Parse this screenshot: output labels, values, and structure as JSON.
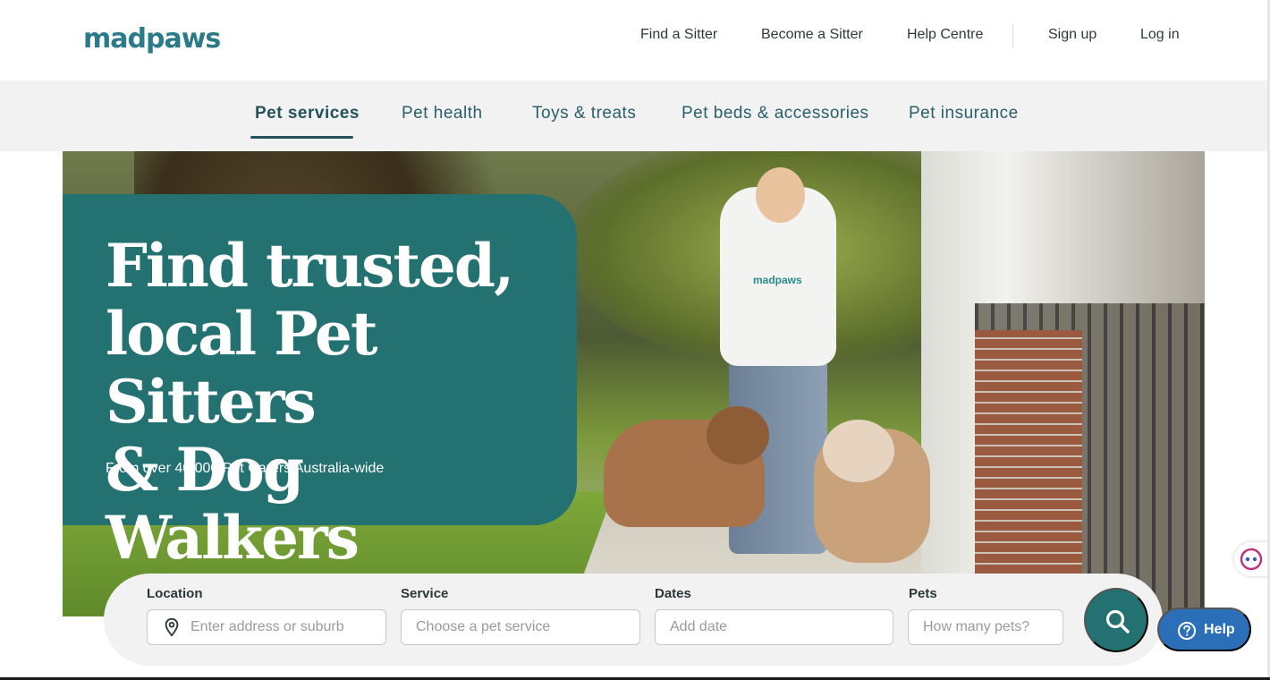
{
  "brand": {
    "logo_text": "madpaws",
    "accent": "#237171",
    "logo_color": "#2a7a8a"
  },
  "topnav": {
    "find_sitter": "Find a Sitter",
    "become_sitter": "Become a Sitter",
    "help_centre": "Help Centre",
    "sign_up": "Sign up",
    "log_in": "Log in"
  },
  "categories": [
    {
      "label": "Pet services",
      "active": true
    },
    {
      "label": "Pet health",
      "active": false
    },
    {
      "label": "Toys & treats",
      "active": false
    },
    {
      "label": "Pet beds & accessories",
      "active": false
    },
    {
      "label": "Pet insurance",
      "active": false
    }
  ],
  "hero": {
    "headline_line1": "Find trusted,",
    "headline_line2": "local Pet Sitters",
    "headline_line3": "& Dog Walkers",
    "subline": "From over 40,000 Pet Carers Australia-wide",
    "shirt_logo": "madpaws"
  },
  "search": {
    "location": {
      "label": "Location",
      "placeholder": "Enter address or suburb",
      "icon": "location-pin-icon"
    },
    "service": {
      "label": "Service",
      "placeholder": "Choose a pet service"
    },
    "dates": {
      "label": "Dates",
      "placeholder": "Add date"
    },
    "pets": {
      "label": "Pets",
      "placeholder": "How many pets?"
    },
    "button_icon": "search-icon"
  },
  "floating": {
    "help_label": "Help",
    "help_color": "#2a6fb8"
  }
}
